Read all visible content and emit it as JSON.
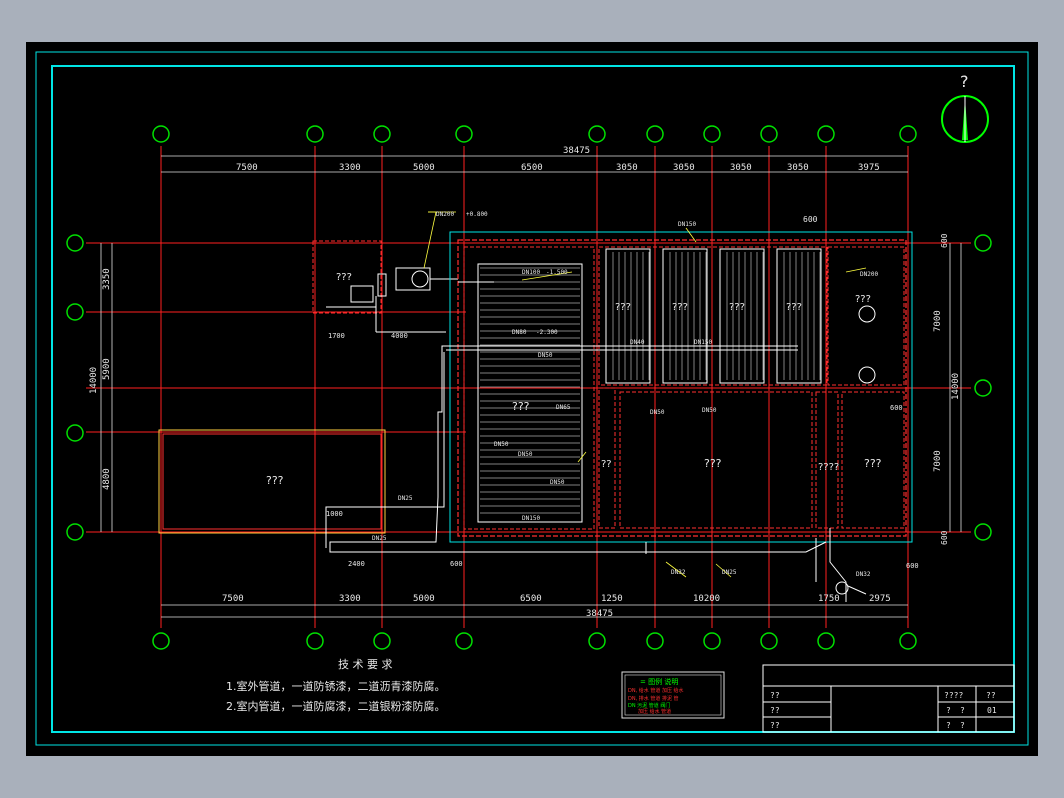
{
  "colors": {
    "background": "#000000",
    "frame": "#00e5e5",
    "grid_circle": "#00e000",
    "axis_line": "#ff2020",
    "dim_line": "#e0e0e0",
    "structure": "#ff3030",
    "pipe": "#ffffff",
    "label": "#e8e8e8",
    "note_yellow": "#ffff40",
    "accent_green": "#00ff00",
    "accent_red": "#ff3030"
  },
  "compass": {
    "symbol": "?"
  },
  "dims": {
    "top_total": "38475",
    "top": [
      "7500",
      "3300",
      "5000",
      "6500",
      "3050",
      "3050",
      "3050",
      "3050",
      "3975"
    ],
    "top_small": "600",
    "bottom": [
      "7500",
      "3300",
      "5000",
      "6500",
      "1250",
      "10200",
      "1750",
      "2975"
    ],
    "bottom_total": "38475",
    "left_total": "14000",
    "left": [
      "3350",
      "5900",
      "4800"
    ],
    "right_total": "14000",
    "right": [
      "600",
      "7000",
      "7000",
      "600"
    ],
    "small_1700": "1700",
    "small_4000": "4000",
    "small_1000": "1000",
    "small_2400": "2400",
    "small_600a": "600",
    "small_600b": "600",
    "small_600c": "600"
  },
  "rooms": {
    "upper_left": "???",
    "lower_left": "???",
    "ramp": "???",
    "tank_big": "???",
    "tank_right": "???",
    "tank_vertical": "????",
    "upper_right": "???",
    "sq_small": "??",
    "filters": [
      "???",
      "???",
      "???",
      "???"
    ]
  },
  "pipe_labels": {
    "dn_a": "DN200",
    "dn_b": "DN150",
    "dn_c": "DN100",
    "dn_d": "DN80",
    "dn_e": "DN50",
    "dn_f": "DN65",
    "dn_g": "DN40",
    "dn_h": "DN25",
    "dn_i": "DN32",
    "el_a": "+0.800",
    "el_b": "-1.500",
    "el_c": "-2.300"
  },
  "notes": {
    "title": "技 术 要 求",
    "line1": "1.室外管道，一道防锈漆，二道沥青漆防腐。",
    "line2": "2.室内管道，一道防腐漆，二道银粉漆防腐。"
  },
  "legend": {
    "title": "= 图例 说明",
    "row1": "DN, 给水 管道 加压 给水",
    "row2": "DN, 排水 管道 排泥 管",
    "row3": "DN 污泥 管道 阀门",
    "row4": "加压 给水 管道"
  },
  "title_block": {
    "c1": "??",
    "c2": "??",
    "c3": "??",
    "c4": "????",
    "c5": "??",
    "c6": "?",
    "c7": "?",
    "c8": "01",
    "c9": "?",
    "c10": "?"
  }
}
